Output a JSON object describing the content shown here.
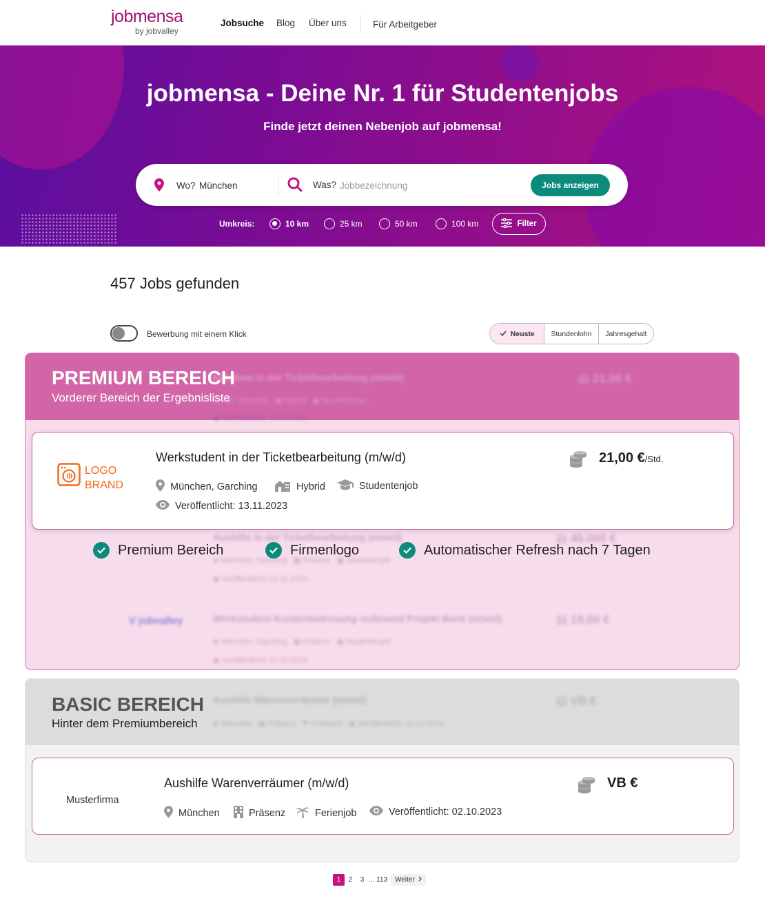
{
  "nav": {
    "logo_main": "jobmensa",
    "logo_sub": "by jobvalley",
    "links": [
      "Jobsuche",
      "Blog",
      "Über uns"
    ],
    "employer": "Für Arbeitgeber"
  },
  "hero": {
    "title": "jobmensa - Deine Nr. 1 für Studentenjobs",
    "subtitle": "Finde jetzt deinen Nebenjob auf jobmensa!",
    "where_label": "Wo?",
    "where_value": "München",
    "what_label": "Was?",
    "what_placeholder": "Jobbezeichnung",
    "submit": "Jobs anzeigen",
    "radius_label": "Umkreis:",
    "radius_options": [
      "10 km",
      "25 km",
      "50 km",
      "100 km"
    ],
    "radius_selected": "10 km",
    "filter": "Filter"
  },
  "results": {
    "count_text": "457 Jobs gefunden",
    "one_click_label": "Bewerbung mit einem Klick",
    "one_click_on": false,
    "sort": [
      "Neuste",
      "Stundenlohn",
      "Jahresgehalt"
    ],
    "sort_selected": "Neuste"
  },
  "premium": {
    "title": "PREMIUM BEREICH",
    "subtitle": "Vorderer Bereich der Ergebnisliste",
    "job": {
      "logo_line1": "LOGO",
      "logo_line2": "BRAND",
      "title": "Werkstudent in der Ticketbearbeitung (m/w/d)",
      "location": "München, Garching",
      "mode": "Hybrid",
      "type": "Studentenjob",
      "published": "Veröffentlicht: 13.11.2023",
      "price": "21,00 €",
      "price_unit": "/Std."
    },
    "features": [
      "Premium Bereich",
      "Firmenlogo",
      "Automatischer Refresh nach 7 Tagen"
    ]
  },
  "basic": {
    "title": "BASIC BEREICH",
    "subtitle": "Hinter dem Premiumbereich",
    "job": {
      "company": "Musterfirma",
      "title": "Aushilfe Warenverräumer (m/w/d)",
      "location": "München",
      "mode": "Präsenz",
      "type": "Ferienjob",
      "published": "Veröffentlicht: 02.10.2023",
      "price": "VB €"
    }
  },
  "pagination": {
    "pages": [
      "1",
      "2",
      "3",
      "... 113"
    ],
    "current": "1",
    "next": "Weiter"
  },
  "colors": {
    "brand": "#a0126e",
    "accent_green": "#0c8a7b",
    "premium_header": "#d165a8",
    "premium_body": "#f7dcec",
    "basic_header": "#dcdcdc"
  }
}
